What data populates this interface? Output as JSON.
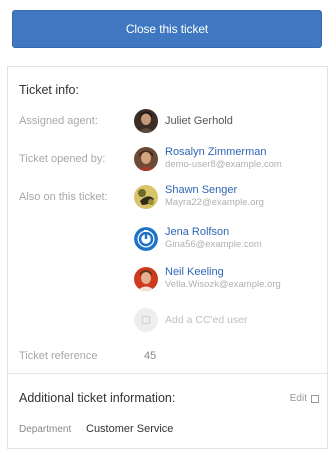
{
  "close_button": {
    "label": "Close this ticket"
  },
  "ticket_info": {
    "title": "Ticket info:",
    "assigned_agent": {
      "label": "Assigned agent:",
      "name": "Juliet Gerhold"
    },
    "opened_by": {
      "label": "Ticket opened by:",
      "name": "Rosalyn Zimmerman",
      "email": "demo-user8@example.com"
    },
    "also_on_ticket": {
      "label": "Also on this ticket:",
      "users": [
        {
          "name": "Shawn Senger",
          "email": "Mayra22@example.org"
        },
        {
          "name": "Jena Rolfson",
          "email": "Gina56@example.com"
        },
        {
          "name": "Neil Keeling",
          "email": "Vella.Wisozk@example.org"
        }
      ],
      "add_cc_label": "Add a CC'ed user"
    },
    "reference": {
      "label": "Ticket reference",
      "value": "45"
    }
  },
  "additional_info": {
    "title": "Additional ticket information:",
    "edit_label": "Edit",
    "department": {
      "label": "Department",
      "value": "Customer Service"
    }
  },
  "colors": {
    "primary_button": "#3f78c0",
    "link": "#2f66b3"
  }
}
